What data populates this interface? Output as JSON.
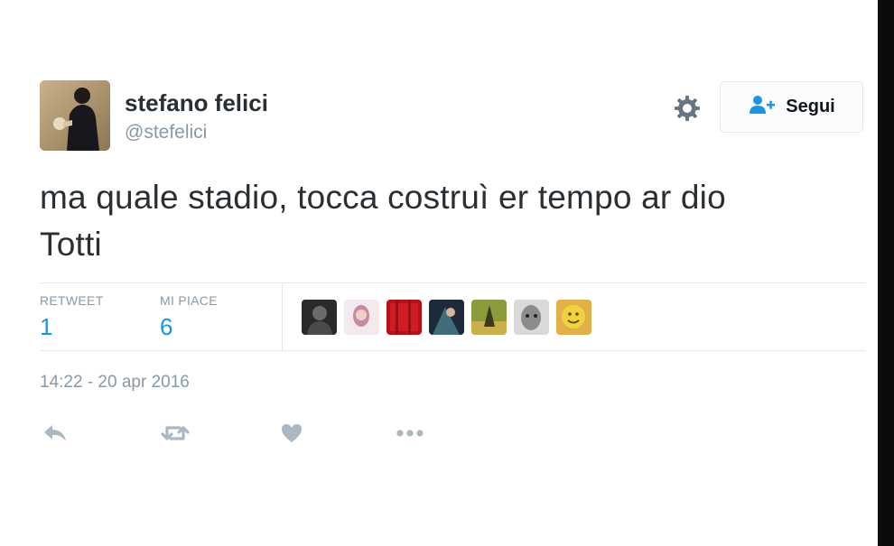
{
  "user": {
    "name": "stefano felici",
    "handle": "@stefelici"
  },
  "follow_button": {
    "label": "Segui",
    "icon": "add-user-icon"
  },
  "settings_icon": "gear-icon",
  "tweet": {
    "text_line1": "ma quale stadio, tocca costruì er tempo ar dio",
    "text_line2": "Totti"
  },
  "stats": {
    "retweet_label": "RETWEET",
    "retweet_count": "1",
    "likes_label": "MI PIACE",
    "likes_count": "6"
  },
  "likers_count_shown": 7,
  "timestamp": "14:22 - 20 apr 2016",
  "actions": [
    "reply-icon",
    "retweet-icon",
    "like-icon",
    "more-icon"
  ],
  "colors": {
    "accent_blue": "#1b95e0",
    "muted_gray": "#8899a6",
    "text_dark": "#292f33"
  }
}
